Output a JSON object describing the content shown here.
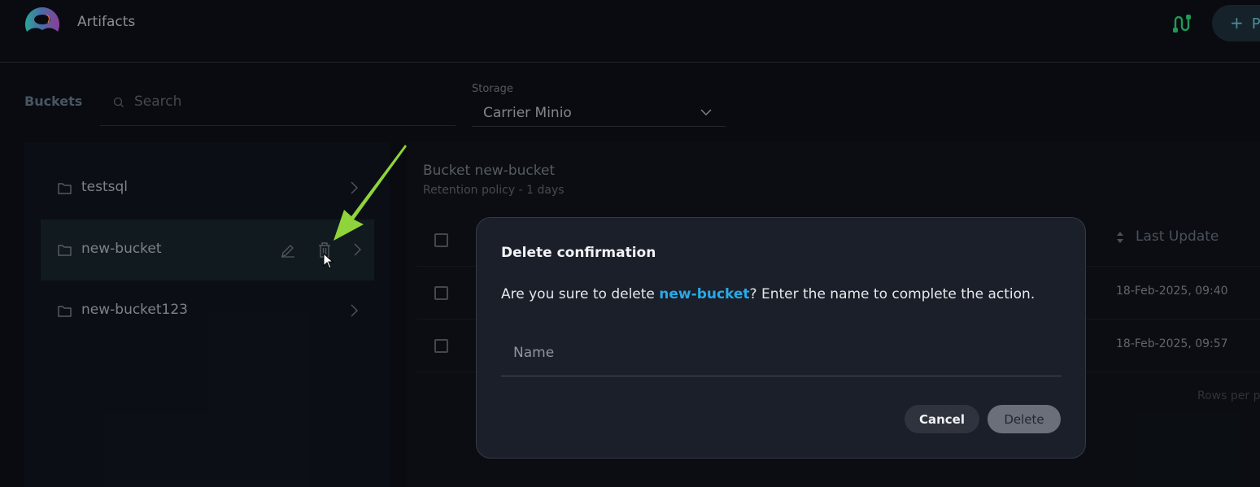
{
  "header": {
    "app_title": "Artifacts",
    "logo": "app-logo",
    "integrations_icon": "integrations-icon",
    "add_button_label": "P",
    "add_button_icon": "+"
  },
  "toolbar": {
    "buckets_label": "Buckets",
    "search_placeholder": "Search",
    "search_value": "",
    "storage_label": "Storage",
    "storage_selected": "Carrier Minio"
  },
  "buckets": [
    {
      "name": "testsql",
      "selected": false
    },
    {
      "name": "new-bucket",
      "selected": true
    },
    {
      "name": "new-bucket123",
      "selected": false
    }
  ],
  "bucket_detail": {
    "title": "Bucket new-bucket",
    "retention": "Retention policy - 1 days",
    "table": {
      "columns": [
        "",
        "Last Update"
      ],
      "rows": [
        {
          "last_update": "18-Feb-2025, 09:40"
        },
        {
          "last_update": "18-Feb-2025, 09:57"
        }
      ],
      "rows_per_page_label": "Rows per p"
    }
  },
  "modal": {
    "title": "Delete confirmation",
    "text_before": "Are you sure to delete ",
    "highlight": "new-bucket",
    "text_after": "?  Enter the name to complete the action.",
    "name_placeholder": "Name",
    "name_value": "",
    "cancel_label": "Cancel",
    "delete_label": "Delete"
  },
  "colors": {
    "accent_link": "#29a9e6",
    "integration_green": "#1f9a55",
    "annotation_arrow": "#8fd43a"
  }
}
